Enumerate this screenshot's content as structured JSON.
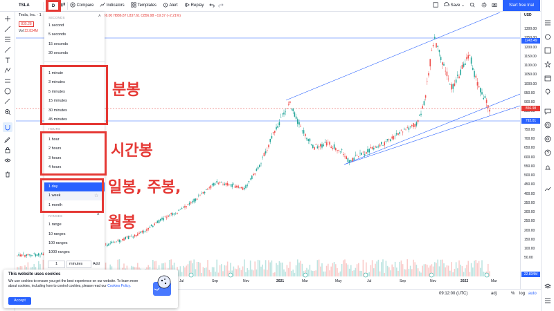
{
  "toolbar": {
    "symbol": "TSLA",
    "interval": "D",
    "compare": "Compare",
    "indicators": "Indicators",
    "templates": "Templates",
    "alert": "Alert",
    "replay": "Replay",
    "save": "Save",
    "start_trial": "Start free trial"
  },
  "legend": {
    "name": "Tesla, Inc. · 1",
    "ohlc": "O886.00 H886.87 L837.61 C856.98 −19.37 (−2.21%)",
    "price_box": "835.28",
    "vol_label": "Vol",
    "vol_value": "22.834M"
  },
  "interval_menu": {
    "sections": {
      "seconds": "SECONDS",
      "hours": "HOURS",
      "days": "DAYS",
      "ranges": "RANGES"
    },
    "seconds": [
      "1 second",
      "5 seconds",
      "15 seconds",
      "30 seconds"
    ],
    "minutes": [
      "1 minute",
      "3 minutes",
      "5 minutes",
      "15 minutes",
      "30 minutes",
      "45 minutes"
    ],
    "hours": [
      "1 hour",
      "2 hours",
      "3 hours",
      "4 hours"
    ],
    "days": [
      "1 day",
      "1 week",
      "1 month"
    ],
    "ranges": [
      "1 range",
      "10 ranges",
      "100 ranges",
      "1000 ranges"
    ],
    "custom": {
      "value": "1",
      "unit": "minutes",
      "add": "Add"
    }
  },
  "annotations": {
    "minutes": "분봉",
    "hours": "시간봉",
    "days_line1": "일봉, 주봉,",
    "days_line2": "월봉"
  },
  "price_axis": {
    "currency": "USD",
    "ticks": [
      "1300.00",
      "1250.00",
      "1200.00",
      "1150.00",
      "1100.00",
      "1050.00",
      "1000.00",
      "950.00",
      "900.00",
      "850.00",
      "800.00",
      "750.00",
      "700.00",
      "650.00",
      "600.00",
      "550.00",
      "500.00",
      "450.00",
      "400.00",
      "350.00",
      "300.00",
      "250.00",
      "200.00",
      "150.00",
      "100.00",
      "50.00"
    ],
    "badge_high": "1243.49",
    "badge_last": "856.98",
    "badge_low": "792.01",
    "badge_vol": "22.834M"
  },
  "time_axis": {
    "ticks": [
      "Jul",
      "Sep",
      "Nov",
      "2021",
      "Mar",
      "May",
      "Jul",
      "Sep",
      "Nov",
      "2022",
      "Mar"
    ]
  },
  "bottom": {
    "time": "09:12:00 (UTC)",
    "pct": "%",
    "log": "log",
    "auto": "auto",
    "adj": "adj"
  },
  "cookie": {
    "title": "This website uses cookies",
    "text": "We use cookies to ensure you get the best experience on our website. To learn more about cookies, including how to control cookies, please read our",
    "link": "Cookies Policy.",
    "accept": "Accept"
  },
  "colors": {
    "accent": "#2962ff",
    "annotation": "#e53935",
    "up": "#26a69a",
    "down": "#ef5350"
  }
}
